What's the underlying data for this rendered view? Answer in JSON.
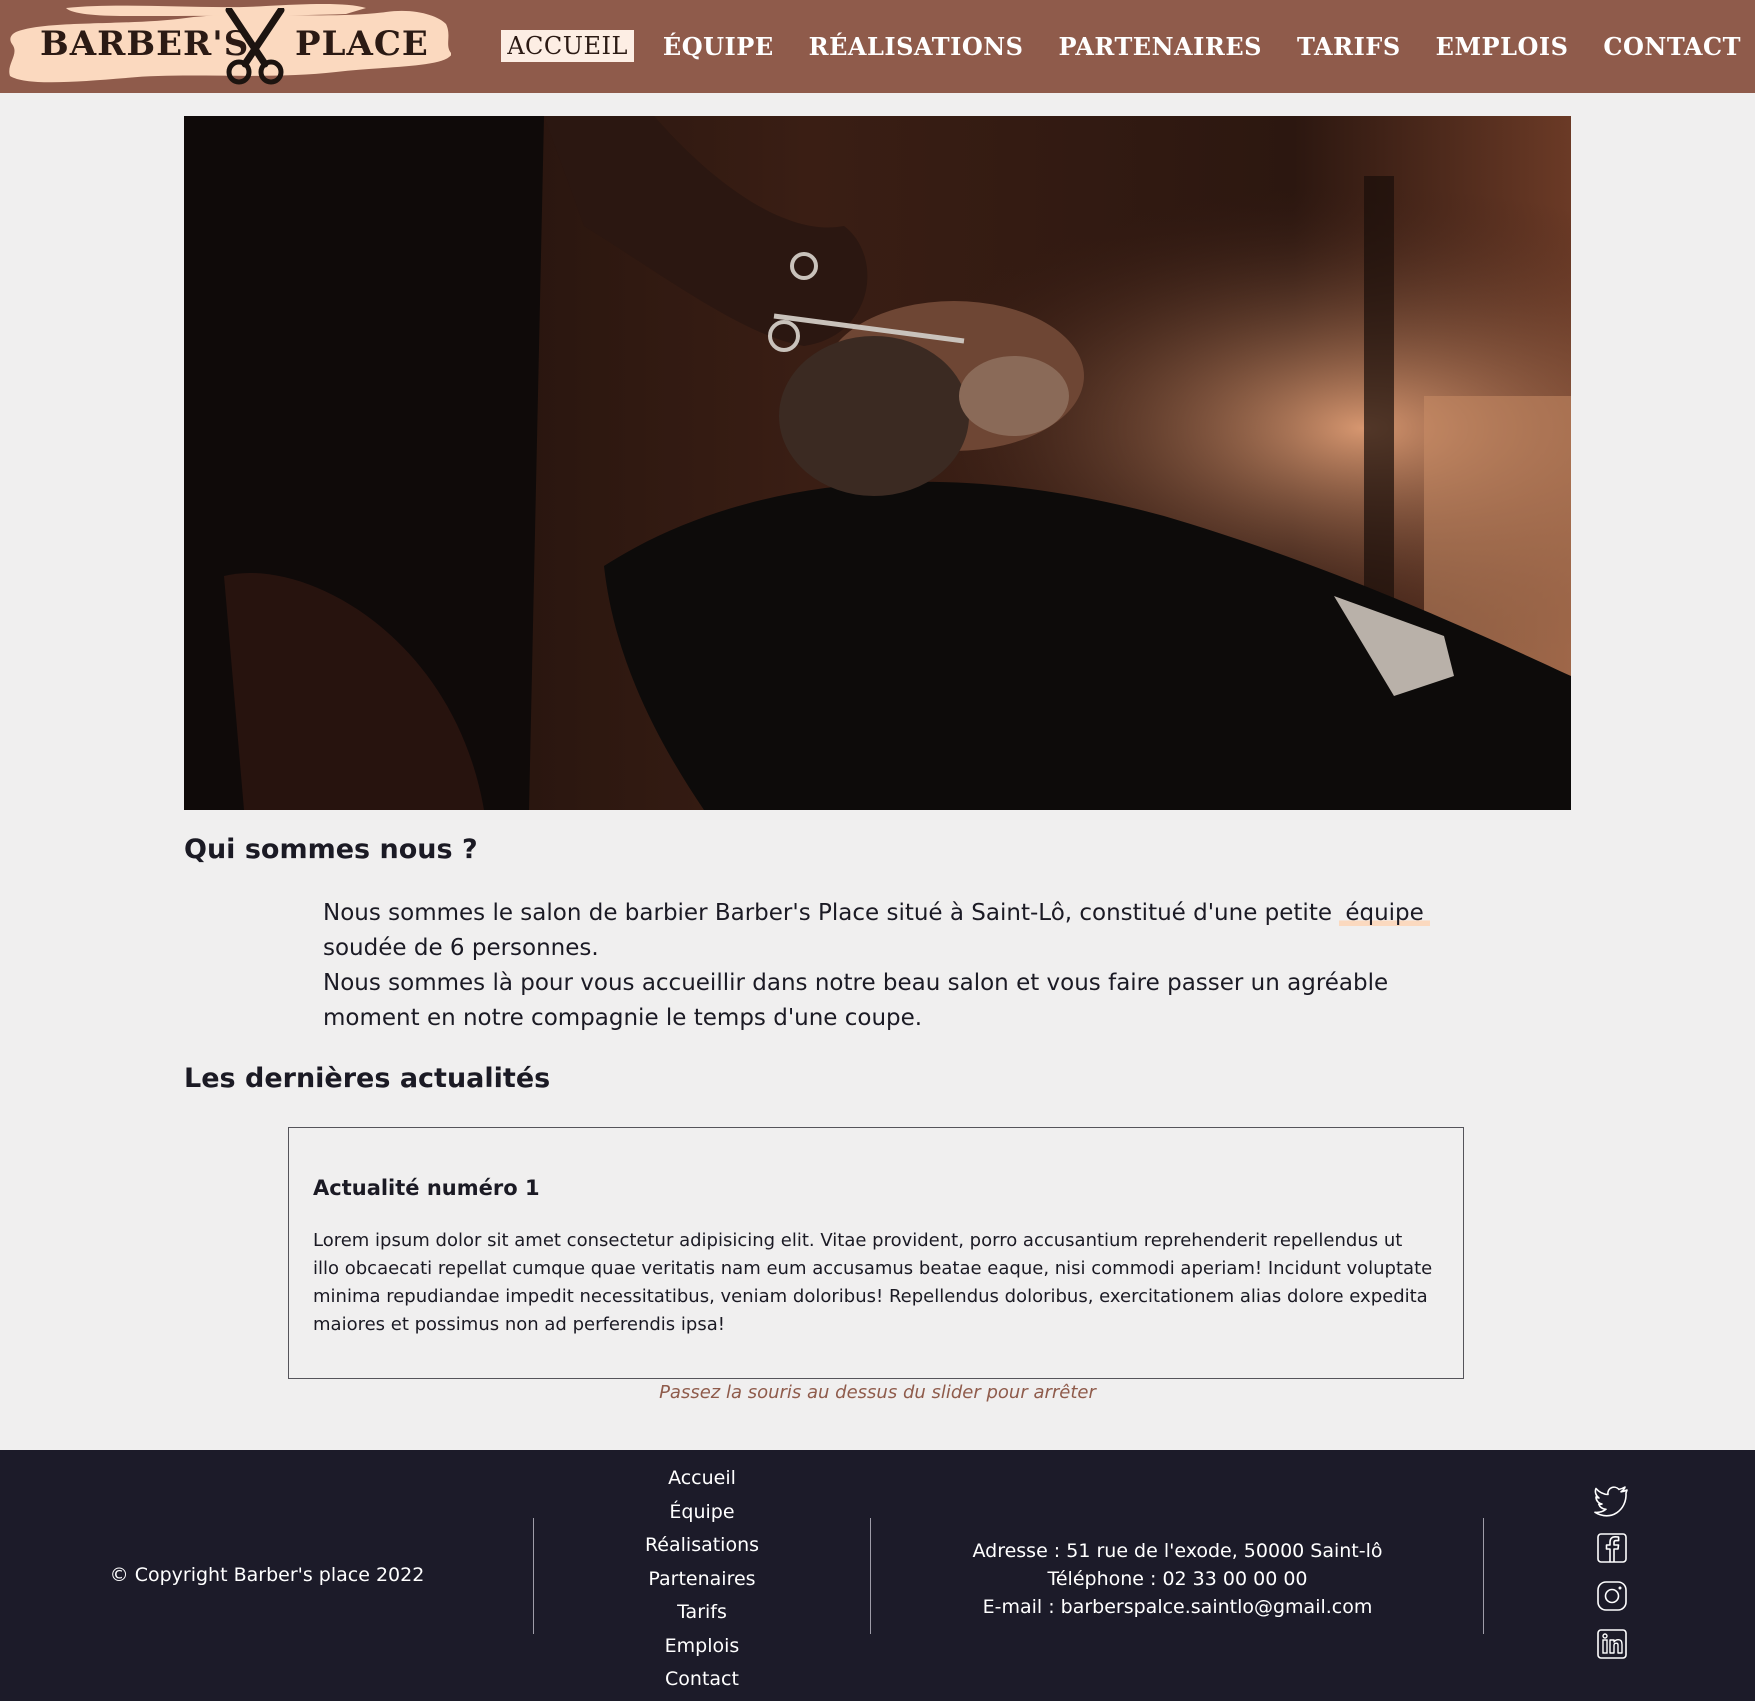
{
  "header": {
    "logo": {
      "left_text": "BARBER'S",
      "right_text": "PLACE"
    },
    "nav": [
      {
        "label": "ACCUEIL",
        "active": true
      },
      {
        "label": "ÉQUIPE",
        "active": false
      },
      {
        "label": "RÉALISATIONS",
        "active": false
      },
      {
        "label": "PARTENAIRES",
        "active": false
      },
      {
        "label": "TARIFS",
        "active": false
      },
      {
        "label": "EMPLOIS",
        "active": false
      },
      {
        "label": "CONTACT",
        "active": false
      }
    ]
  },
  "about": {
    "title": "Qui sommes nous ?",
    "line1_before": "Nous sommes le salon de barbier Barber's Place situé à Saint-Lô, constitué d'une petite",
    "line1_link": "équipe",
    "line1_after": "soudée de 6 personnes.",
    "line2": "Nous sommes là pour vous accueillir dans notre beau salon et vous faire passer un agréable moment en notre compagnie le temps d'une coupe."
  },
  "news": {
    "title": "Les dernières actualités",
    "item_title": "Actualité numéro 1",
    "item_text": "Lorem ipsum dolor sit amet consectetur adipisicing elit. Vitae provident, porro accusantium reprehenderit repellendus ut illo obcaecati repellat cumque quae veritatis nam eum accusamus beatae eaque, nisi commodi aperiam! Incidunt voluptate minima repudiandae impedit necessitatibus, veniam doloribus! Repellendus doloribus, exercitationem alias dolore expedita maiores et possimus non ad perferendis ipsa!",
    "hint": "Passez la souris au dessus du slider pour arrêter"
  },
  "footer": {
    "copyright": "© Copyright Barber's place 2022",
    "links": [
      "Accueil",
      "Équipe",
      "Réalisations",
      "Partenaires",
      "Tarifs",
      "Emplois",
      "Contact"
    ],
    "address": "Adresse : 51 rue de l'exode, 50000 Saint-lô",
    "phone": "Téléphone : 02 33 00 00 00",
    "email": "E-mail : barberspalce.saintlo@gmail.com",
    "socials": [
      "twitter-icon",
      "facebook-icon",
      "instagram-icon",
      "linkedin-icon"
    ]
  },
  "colors": {
    "header_bg": "#8f5b4b",
    "page_bg": "#f0efef",
    "footer_bg": "#1c1b29",
    "accent": "#fbd9bf",
    "active_nav_bg": "#fdeee4"
  }
}
